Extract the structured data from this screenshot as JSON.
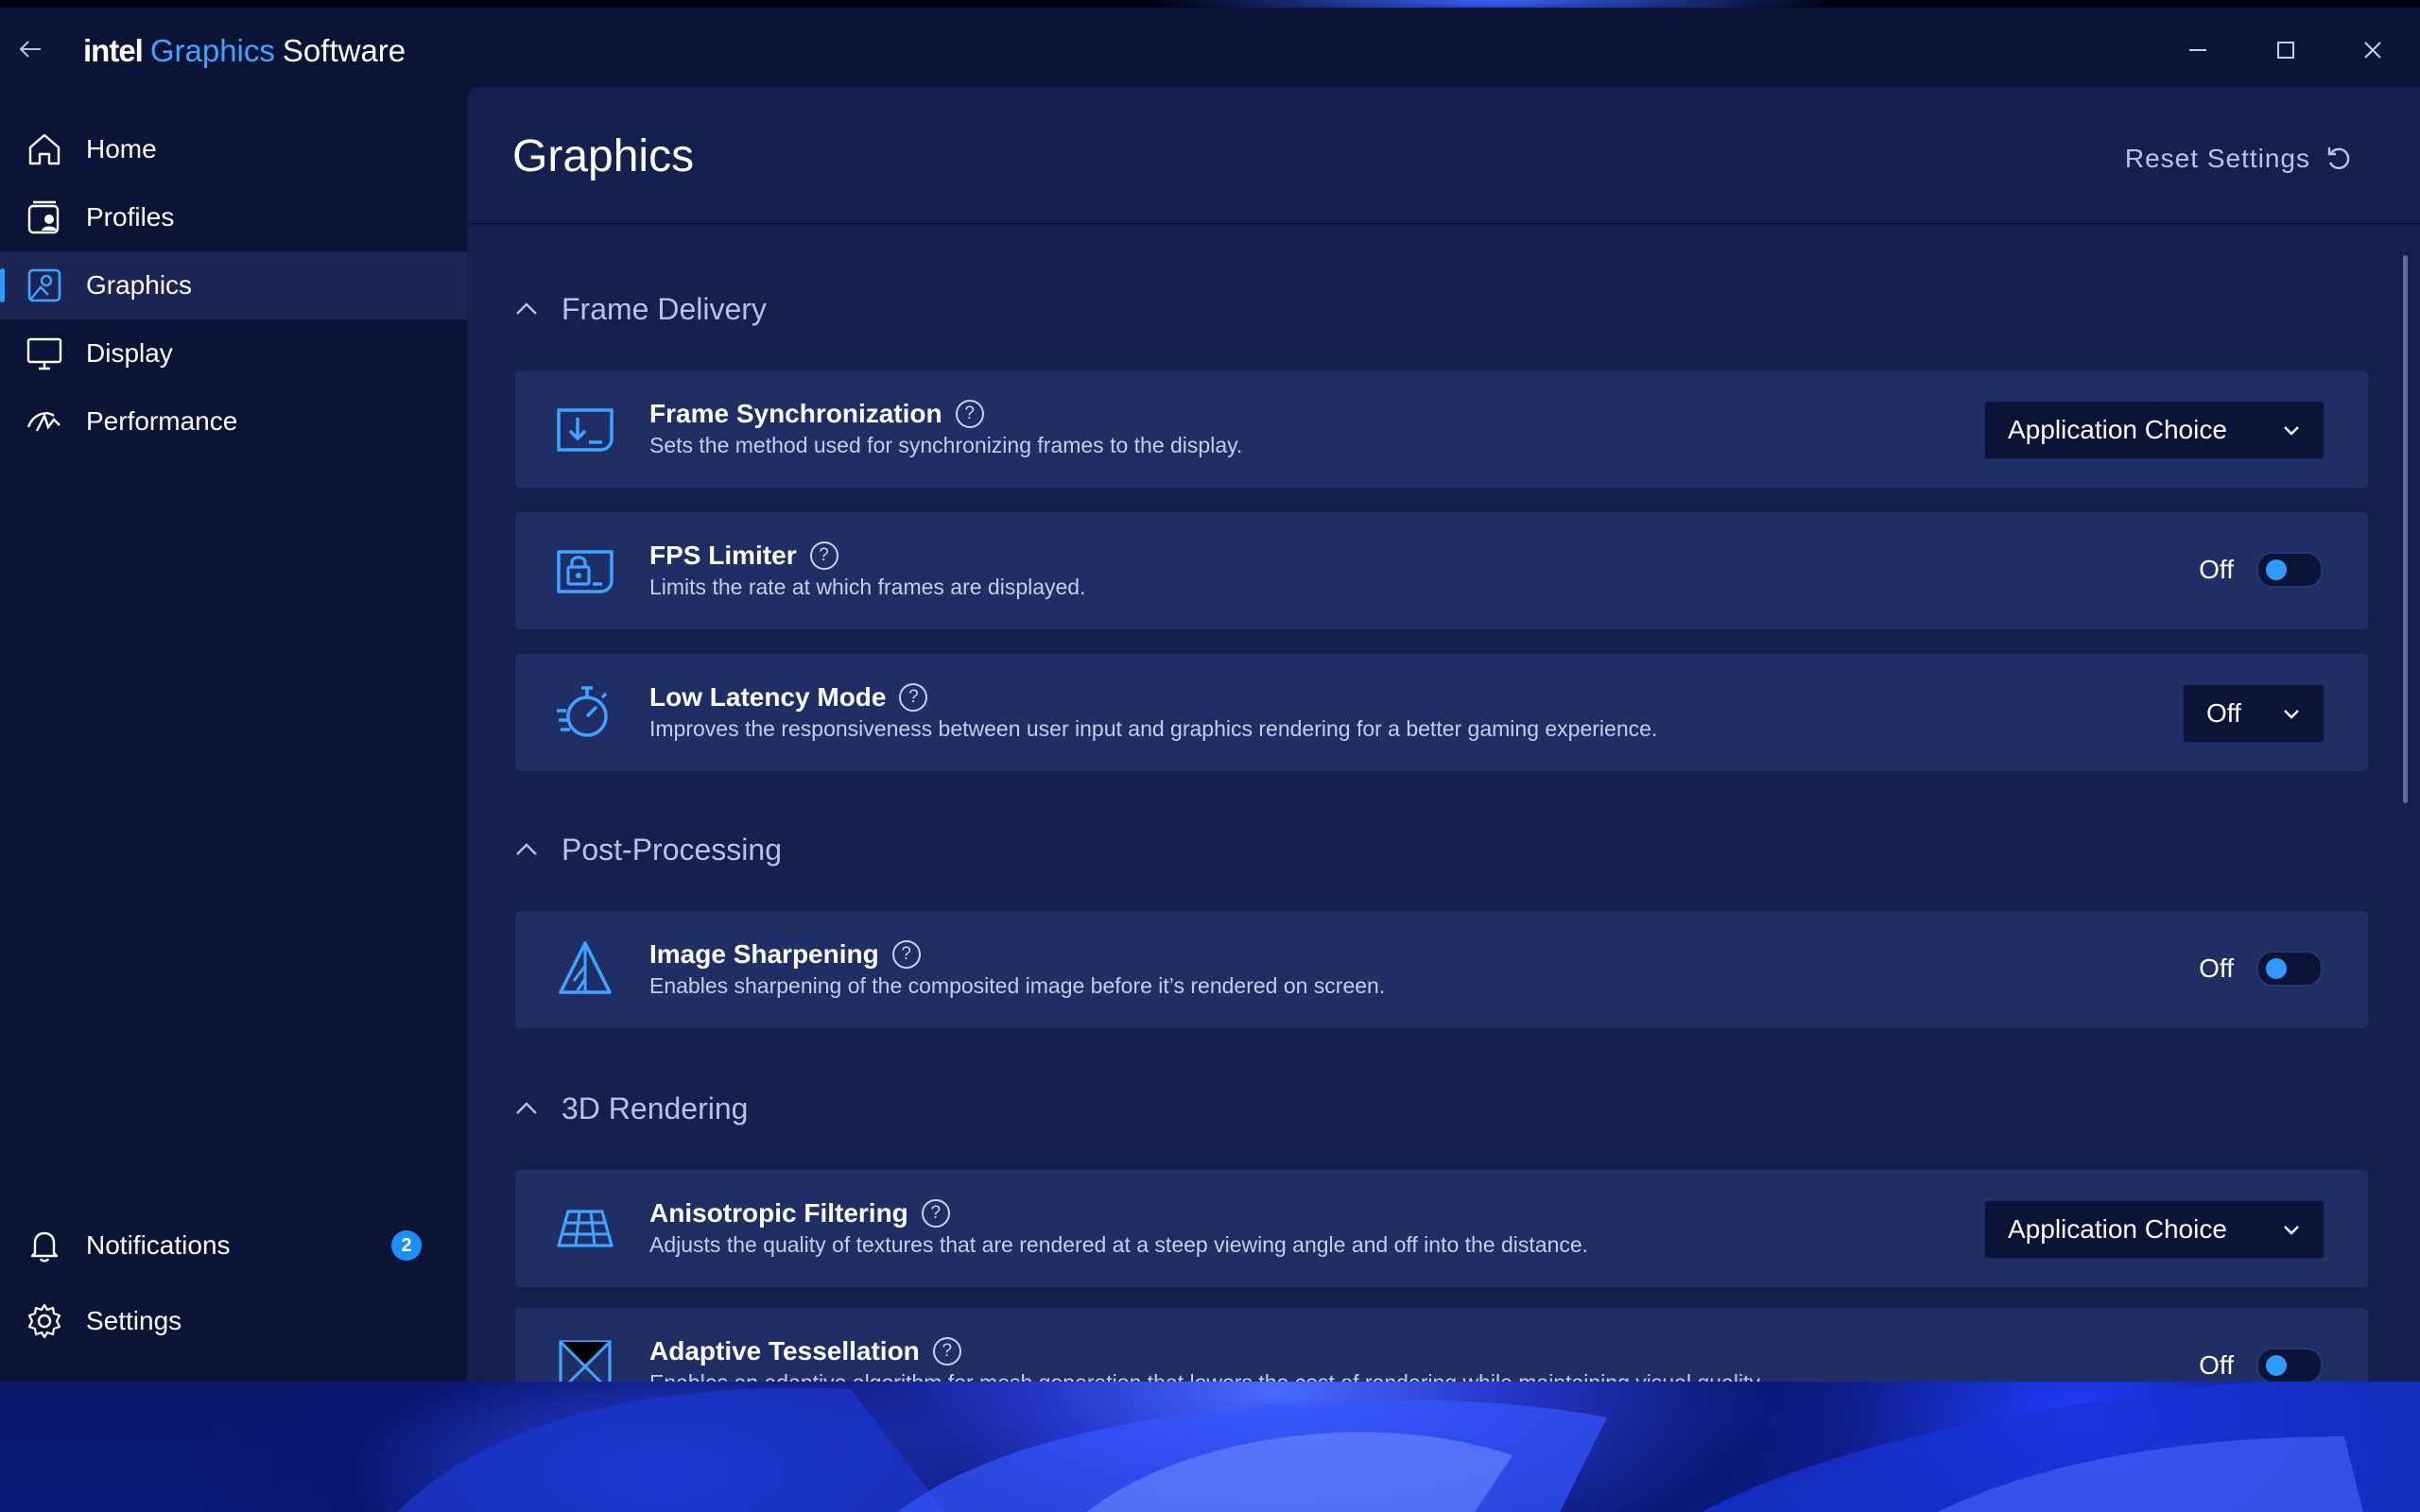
{
  "window": {
    "brand_intel": "intel",
    "brand_graphics": "Graphics",
    "brand_software": "Software"
  },
  "sidebar": {
    "items": [
      {
        "label": "Home",
        "icon": "home-icon"
      },
      {
        "label": "Profiles",
        "icon": "profiles-icon"
      },
      {
        "label": "Graphics",
        "icon": "graphics-icon",
        "active": true
      },
      {
        "label": "Display",
        "icon": "display-icon"
      },
      {
        "label": "Performance",
        "icon": "performance-icon"
      }
    ],
    "notifications": {
      "label": "Notifications",
      "count": "2"
    },
    "settings": {
      "label": "Settings"
    }
  },
  "main": {
    "title": "Graphics",
    "reset_label": "Reset Settings",
    "sections": [
      {
        "title": "Frame Delivery",
        "settings": [
          {
            "title": "Frame Synchronization",
            "desc": "Sets the method used for synchronizing frames to the display.",
            "control": "dropdown",
            "value": "Application Choice"
          },
          {
            "title": "FPS Limiter",
            "desc": "Limits the rate at which frames are displayed.",
            "control": "toggle",
            "value": "Off"
          },
          {
            "title": "Low Latency Mode",
            "desc": "Improves the responsiveness between user input and graphics rendering for a better gaming experience.",
            "control": "dropdown",
            "value": "Off"
          }
        ]
      },
      {
        "title": "Post-Processing",
        "settings": [
          {
            "title": "Image Sharpening",
            "desc": "Enables sharpening of the composited image before it’s rendered on screen.",
            "control": "toggle",
            "value": "Off"
          }
        ]
      },
      {
        "title": "3D Rendering",
        "settings": [
          {
            "title": "Anisotropic Filtering",
            "desc": "Adjusts the quality of textures that are rendered at a steep viewing angle and off into the distance.",
            "control": "dropdown",
            "value": "Application Choice"
          },
          {
            "title": "Adaptive Tessellation",
            "desc": "Enables an adaptive algorithm for mesh generation that lowers the cost of rendering while maintaining visual quality.",
            "control": "toggle",
            "value": "Off"
          }
        ]
      }
    ]
  },
  "help_glyph": "?",
  "colors": {
    "accent": "#2d9bff",
    "brand_blue": "#3fa4ff",
    "panel": "#14214f",
    "card": "#1f2f66",
    "window": "#0b1437"
  }
}
